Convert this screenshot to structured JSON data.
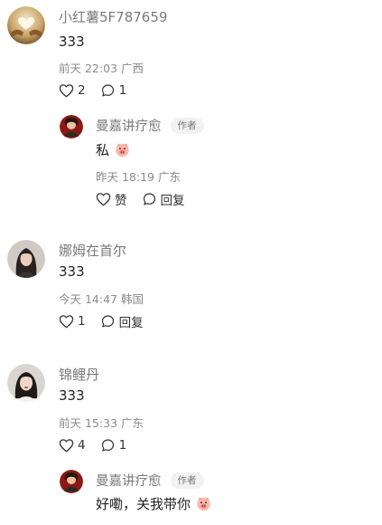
{
  "comments": [
    {
      "author": "小红薯5F787659",
      "content": "333",
      "time": "前天 22:03",
      "location": "广西",
      "likes": "2",
      "replies": "1",
      "reply": {
        "author": "曼嘉讲疗愈",
        "badge": "作者",
        "content": "私",
        "time": "昨天 18:19",
        "location": "广东",
        "like_label": "赞",
        "reply_label": "回复"
      }
    },
    {
      "author": "娜姆在首尔",
      "content": "333",
      "time": "今天 14:47",
      "location": "韩国",
      "likes": "1",
      "reply_label": "回复"
    },
    {
      "author": "锦鲤丹",
      "content": "333",
      "time": "前天 15:33",
      "location": "广东",
      "likes": "4",
      "replies": "1",
      "reply": {
        "author": "曼嘉讲疗愈",
        "badge": "作者",
        "content": "好嘞，关我带你"
      }
    }
  ],
  "icons": {
    "like": "heart-outline-icon",
    "comment": "speech-bubble-icon",
    "emoji": "pig-face-emoji-icon"
  },
  "colors": {
    "author": "#7a7a7a",
    "meta": "#8a8a8a",
    "text": "#222222",
    "badge_bg": "#f2f2f2"
  }
}
